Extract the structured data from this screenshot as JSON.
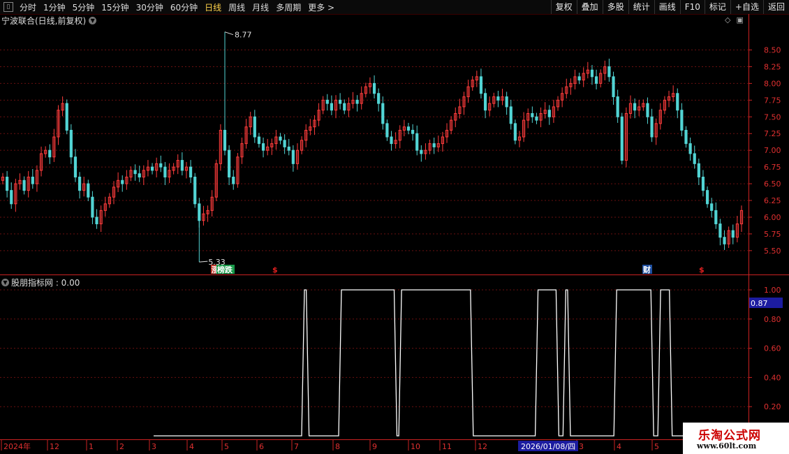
{
  "toolbar": {
    "timeframes": [
      "分时",
      "1分钟",
      "5分钟",
      "15分钟",
      "30分钟",
      "60分钟",
      "日线",
      "周线",
      "月线",
      "多周期",
      "更多 >"
    ],
    "active": "日线",
    "tools": [
      "复权",
      "叠加",
      "多股",
      "统计",
      "画线",
      "F10",
      "标记",
      "+自选",
      "返回"
    ]
  },
  "main": {
    "title": "宁波联合(日线,前复权)",
    "max_label": "8.77",
    "min_label": "5.33",
    "event_tags": [
      {
        "text": "涨",
        "bg": "#c0392b",
        "fg": "#fff"
      },
      {
        "text": "榜跌",
        "bg": "#1a9a4a",
        "fg": "#fff"
      },
      {
        "text": "$",
        "bg": "",
        "fg": "#e02020"
      },
      {
        "text": "财",
        "bg": "#1f4fa0",
        "fg": "#fff"
      },
      {
        "text": "$",
        "bg": "",
        "fg": "#e02020"
      }
    ]
  },
  "indicator": {
    "title": "股朋指标网 : 0.00",
    "cursor_value": "0.87"
  },
  "xaxis": {
    "labels": [
      "2024年",
      "12",
      "1",
      "2",
      "3",
      "4",
      "5",
      "6",
      "7",
      "8",
      "9",
      "10",
      "11",
      "12",
      "1",
      "3",
      "4",
      "5"
    ],
    "cursor_date": "2026/01/08/四"
  },
  "watermark": {
    "line1": "乐淘公式网",
    "line2": "www.60lt.com"
  },
  "colors": {
    "up": "#ff3c3c",
    "down": "#52d4d4",
    "axis": "#cc2222",
    "grid": "#6a1010",
    "indicator": "#ffffff",
    "highlight": "#1c1ca0"
  },
  "chart_data": [
    {
      "type": "candlestick",
      "title": "宁波联合(日线,前复权)",
      "ylim": [
        5.3,
        8.85
      ],
      "yticks": [
        5.5,
        5.75,
        6.0,
        6.25,
        6.5,
        6.75,
        7.0,
        7.25,
        7.5,
        7.75,
        8.0,
        8.25,
        8.5
      ],
      "max": 8.77,
      "min": 5.33,
      "closes": [
        6.6,
        6.4,
        6.2,
        6.5,
        6.55,
        6.4,
        6.6,
        6.5,
        6.7,
        6.95,
        7.0,
        6.9,
        7.2,
        7.6,
        7.7,
        7.3,
        6.9,
        6.6,
        6.4,
        6.5,
        6.3,
        6.0,
        5.9,
        6.1,
        6.2,
        6.3,
        6.45,
        6.55,
        6.5,
        6.6,
        6.7,
        6.65,
        6.6,
        6.7,
        6.75,
        6.7,
        6.8,
        6.75,
        6.6,
        6.7,
        6.75,
        6.85,
        6.7,
        6.75,
        6.6,
        6.2,
        5.95,
        6.05,
        6.1,
        6.3,
        6.8,
        7.3,
        7.0,
        6.6,
        6.5,
        6.9,
        7.1,
        7.35,
        7.5,
        7.2,
        7.1,
        7.0,
        7.05,
        7.1,
        7.2,
        7.15,
        7.05,
        7.0,
        6.8,
        7.0,
        7.15,
        7.3,
        7.35,
        7.45,
        7.6,
        7.75,
        7.7,
        7.6,
        7.75,
        7.7,
        7.6,
        7.7,
        7.75,
        7.7,
        7.85,
        7.95,
        8.0,
        7.85,
        7.7,
        7.4,
        7.2,
        7.1,
        7.15,
        7.3,
        7.35,
        7.3,
        7.25,
        7.0,
        6.95,
        7.0,
        7.1,
        7.05,
        7.1,
        7.2,
        7.3,
        7.45,
        7.55,
        7.65,
        7.8,
        7.95,
        8.05,
        8.1,
        7.85,
        7.6,
        7.7,
        7.8,
        7.75,
        7.8,
        7.65,
        7.4,
        7.15,
        7.2,
        7.45,
        7.55,
        7.5,
        7.45,
        7.55,
        7.6,
        7.5,
        7.65,
        7.75,
        7.85,
        7.95,
        8.0,
        8.1,
        8.05,
        8.15,
        8.2,
        8.1,
        8.0,
        8.15,
        8.25,
        8.1,
        7.8,
        7.5,
        6.85,
        7.55,
        7.7,
        7.6,
        7.65,
        7.7,
        7.5,
        7.2,
        7.4,
        7.6,
        7.75,
        7.8,
        7.85,
        7.6,
        7.3,
        7.1,
        6.95,
        6.8,
        6.6,
        6.4,
        6.2,
        6.1,
        5.9,
        5.7,
        5.6,
        5.8,
        5.7,
        5.9,
        6.1
      ]
    },
    {
      "type": "line",
      "title": "股朋指标网",
      "ylim": [
        0,
        1.0
      ],
      "yticks": [
        0.2,
        0.4,
        0.6,
        0.8,
        1.0
      ],
      "segments_high": [
        [
          64,
          66
        ],
        [
          80,
          104
        ],
        [
          106,
          137
        ],
        [
          165,
          174
        ],
        [
          177,
          179
        ],
        [
          199,
          215
        ],
        [
          218,
          223
        ]
      ],
      "total_bars": 256
    }
  ]
}
